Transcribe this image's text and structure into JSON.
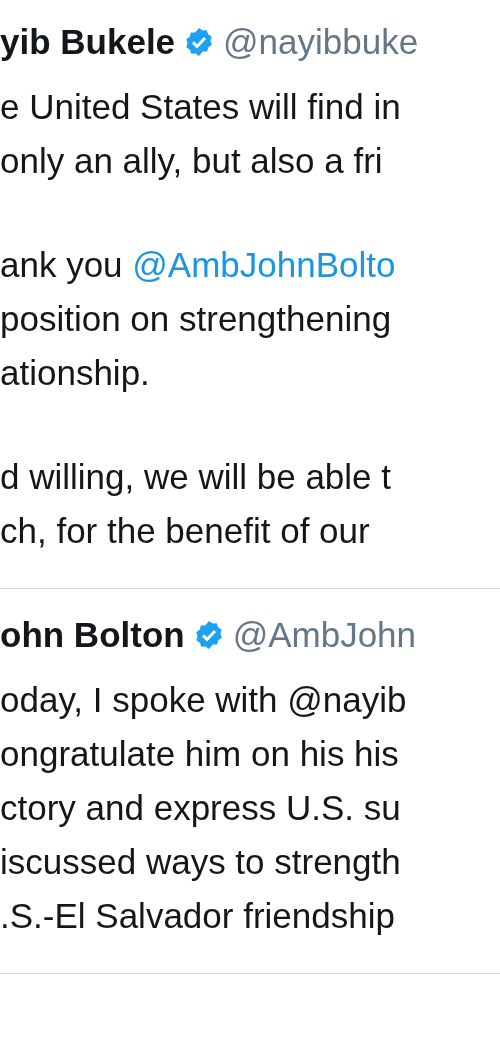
{
  "tweets": [
    {
      "name": "yib Bukele",
      "verified": true,
      "handle": "@nayibbuke",
      "paragraphs": [
        [
          [
            {
              "text": "e United States will find in"
            }
          ],
          [
            {
              "text": "only an ally, but also a fri"
            }
          ]
        ],
        [
          [
            {
              "text": "ank you "
            },
            {
              "text": "@AmbJohnBolto",
              "kind": "link"
            }
          ],
          [
            {
              "text": "position on strengthening"
            }
          ],
          [
            {
              "text": "ationship."
            }
          ]
        ],
        [
          [
            {
              "text": "d willing, we will be able t"
            }
          ],
          [
            {
              "text": "ch, for the benefit of our"
            }
          ]
        ]
      ]
    },
    {
      "name": "ohn Bolton",
      "verified": true,
      "handle": "@AmbJohn",
      "paragraphs": [
        [
          [
            {
              "text": "oday, I spoke with @nayib"
            }
          ],
          [
            {
              "text": "ongratulate him on his his"
            }
          ],
          [
            {
              "text": "ctory and express U.S. su"
            }
          ],
          [
            {
              "text": "iscussed ways to strength"
            }
          ],
          [
            {
              "text": ".S.-El Salvador friendship"
            }
          ]
        ]
      ]
    }
  ]
}
